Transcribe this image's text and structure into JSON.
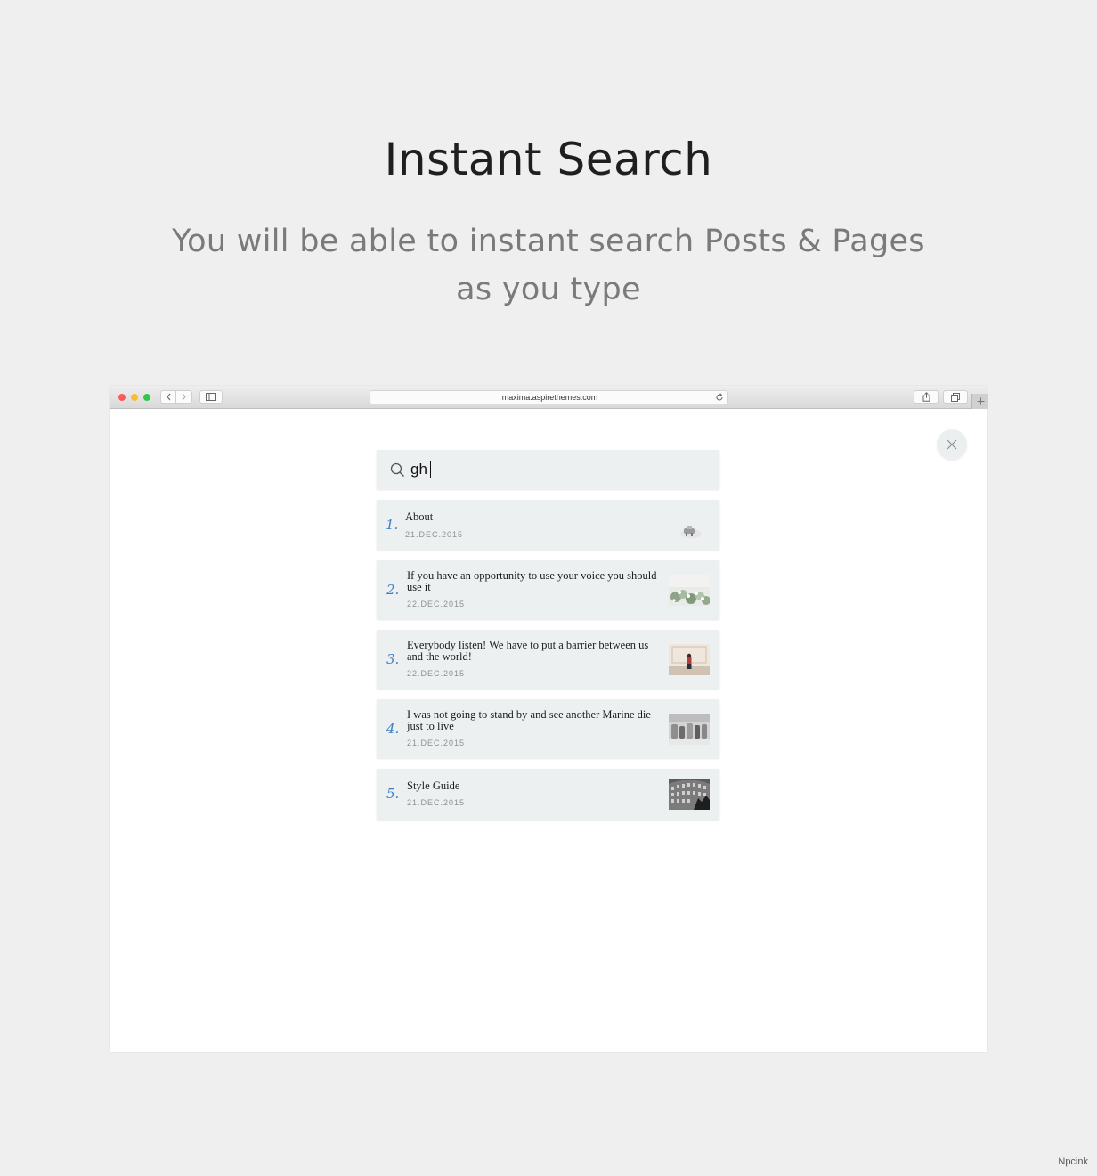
{
  "hero": {
    "title": "Instant Search",
    "subtitle": "You will be able to instant search Posts & Pages as you type"
  },
  "browser": {
    "url": "maxima.aspirethemes.com",
    "icons": {
      "back": "chevron-left-icon",
      "forward": "chevron-right-icon",
      "sidebar": "sidebar-icon",
      "reload": "reload-icon",
      "share": "share-icon",
      "tabs": "tabs-icon",
      "new_tab": "plus-icon"
    }
  },
  "search": {
    "query": "gh",
    "icon": "search-icon",
    "close_icon": "close-icon"
  },
  "results": [
    {
      "num": "1.",
      "title": "About",
      "date": "21.DEC.2015",
      "thumb": "about"
    },
    {
      "num": "2.",
      "title": "If you have an opportunity to use your voice you should use it",
      "date": "22.DEC.2015",
      "thumb": "flowers"
    },
    {
      "num": "3.",
      "title": "Everybody listen! We have to put a barrier between us and the world!",
      "date": "22.DEC.2015",
      "thumb": "person"
    },
    {
      "num": "4.",
      "title": "I was not going to stand by and see another Marine die just to live",
      "date": "21.DEC.2015",
      "thumb": "bottles"
    },
    {
      "num": "5.",
      "title": "Style Guide",
      "date": "21.DEC.2015",
      "thumb": "building"
    }
  ],
  "colors": {
    "background": "#efefef",
    "card": "#edf0f1",
    "accent": "#3d7fc4"
  },
  "watermark": "Npcink"
}
